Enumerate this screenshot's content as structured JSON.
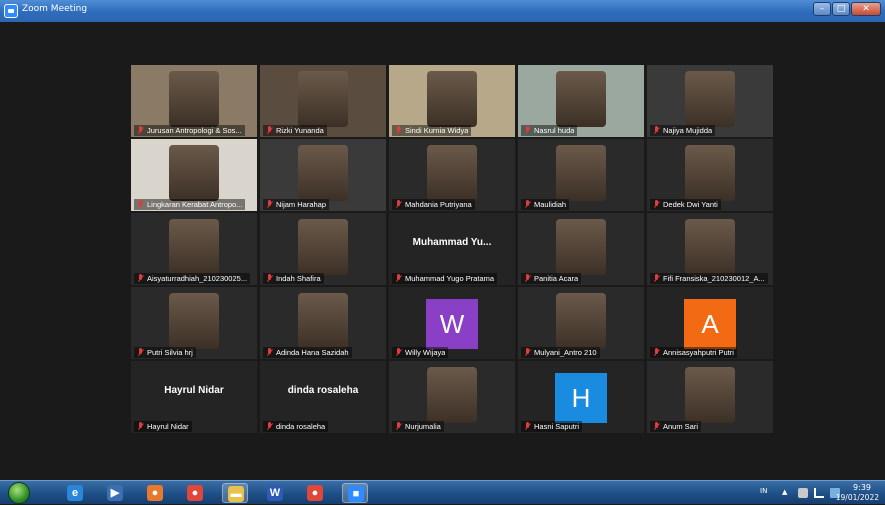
{
  "window": {
    "title": "Zoom Meeting",
    "minimize": "–",
    "maximize": "□",
    "close": "✕"
  },
  "participants": [
    {
      "name": "Jurusan Antropologi & Sos...",
      "type": "video",
      "bg": "#8a7a66"
    },
    {
      "name": "Rizki Yunanda",
      "type": "video",
      "bg": "#5a4c3e"
    },
    {
      "name": "Sindi Kurnia Widya",
      "type": "video",
      "bg": "#b7a889"
    },
    {
      "name": "Nasrul huda",
      "type": "video",
      "bg": "#9aa89f"
    },
    {
      "name": "Najiya Mujidda",
      "type": "video",
      "bg": "#3a3a3a"
    },
    {
      "name": "Lingkaran Kerabat Antropo...",
      "type": "video",
      "bg": "#d9d4cc"
    },
    {
      "name": "Nijam Harahap",
      "type": "video",
      "bg": "#3a3a3a"
    },
    {
      "name": "Mahdania Putriyana",
      "type": "video",
      "bg": "#2a2a2a"
    },
    {
      "name": "Maulidiah",
      "type": "video",
      "bg": "#2a2a2a"
    },
    {
      "name": "Dedek Dwi Yanti",
      "type": "video",
      "bg": "#2a2a2a"
    },
    {
      "name": "Aisyaturradhiah_210230025...",
      "type": "video",
      "bg": "#2a2a2a"
    },
    {
      "name": "Indah Shafira",
      "type": "video",
      "bg": "#2a2a2a"
    },
    {
      "name": "Muhammad Yugo Pratama",
      "type": "text",
      "display": "Muhammad Yu...",
      "bg": "#242424"
    },
    {
      "name": "Panitia Acara",
      "type": "video",
      "bg": "#2a2a2a"
    },
    {
      "name": "Fifi Fransiska_210230012_A...",
      "type": "video",
      "bg": "#2a2a2a"
    },
    {
      "name": "Putri Silvia hrj",
      "type": "video",
      "bg": "#2a2a2a"
    },
    {
      "name": "Adinda Hana Sazidah",
      "type": "video",
      "bg": "#2a2a2a"
    },
    {
      "name": "Willy Wijaya",
      "type": "avatar",
      "letter": "W",
      "color": "#8a3fc7"
    },
    {
      "name": "Mulyani_Antro 210",
      "type": "video",
      "bg": "#2a2a2a"
    },
    {
      "name": "Annisasyahputri Putri",
      "type": "avatar",
      "letter": "A",
      "color": "#f26b14"
    },
    {
      "name": "Hayrul Nidar",
      "type": "text",
      "display": "Hayrul Nidar",
      "bg": "#242424"
    },
    {
      "name": "dinda rosaleha",
      "type": "text",
      "display": "dinda rosaleha",
      "bg": "#242424"
    },
    {
      "name": "Nurjumalia",
      "type": "video",
      "bg": "#2a2a2a"
    },
    {
      "name": "Hasni Saputri",
      "type": "avatar",
      "letter": "H",
      "color": "#1a8ce0"
    },
    {
      "name": "Anum Sari",
      "type": "video",
      "bg": "#2a2a2a"
    }
  ],
  "taskbar": {
    "apps": [
      {
        "name": "internet-explorer-icon",
        "glyph": "e",
        "color": "#2a86d9"
      },
      {
        "name": "media-player-icon",
        "glyph": "▶",
        "color": "#3a6fb0"
      },
      {
        "name": "firefox-icon",
        "glyph": "●",
        "color": "#e8782a"
      },
      {
        "name": "chrome-icon",
        "glyph": "●",
        "color": "#e0463a"
      },
      {
        "name": "file-explorer-icon",
        "glyph": "▬",
        "color": "#e8c24a"
      },
      {
        "name": "word-icon",
        "glyph": "W",
        "color": "#2b5bb5"
      },
      {
        "name": "chrome-icon-2",
        "glyph": "●",
        "color": "#e0463a"
      },
      {
        "name": "zoom-icon",
        "glyph": "■",
        "color": "#2d8cff"
      }
    ],
    "language": "IN",
    "time": "9:39",
    "date": "19/01/2022"
  }
}
